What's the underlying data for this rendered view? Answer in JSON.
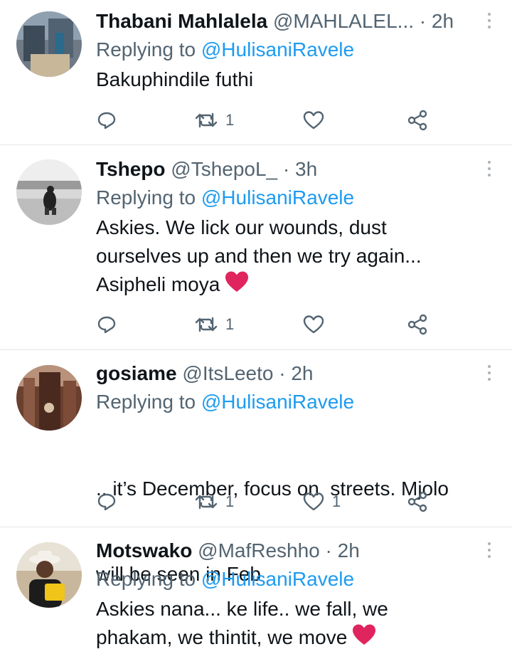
{
  "tweets": [
    {
      "name": "Thabani Mahlalela",
      "handle": "@MAHLALEL...",
      "dot": "·",
      "time": "2h",
      "replying_prefix": "Replying to",
      "replying_to": "@HulisaniRavele",
      "text_lines": [
        "Bakuphindile futhi"
      ],
      "heart_emoji": false,
      "retweets": "1",
      "likes": ""
    },
    {
      "name": "Tshepo",
      "handle": "@TshepoL_",
      "dot": "·",
      "time": "3h",
      "replying_prefix": "Replying to",
      "replying_to": "@HulisaniRavele",
      "text_lines": [
        "Askies. We lick our wounds, dust",
        "ourselves up and then we try again...",
        "Asipheli moya"
      ],
      "heart_emoji": true,
      "retweets": "1",
      "likes": ""
    },
    {
      "name": "gosiame",
      "handle": "@ItsLeeto",
      "dot": "·",
      "time": "2h",
      "replying_prefix": "Replying to",
      "replying_to": "@HulisaniRavele",
      "text_lines": [
        ".. it’s December, focus on  streets. Mjolo",
        "will be seen in Feb"
      ],
      "heart_emoji": false,
      "retweets": "1",
      "likes": "1"
    },
    {
      "name": "Motswako",
      "handle": "@MafReshho",
      "dot": "·",
      "time": "2h",
      "replying_prefix": "Replying to",
      "replying_to": "@HulisaniRavele",
      "text_lines": [
        "Askies nana... ke life.. we fall, we",
        "phakam, we thintit, we move"
      ],
      "heart_emoji": true,
      "retweets": "",
      "likes": ""
    }
  ],
  "icons": {
    "reply": "reply-icon",
    "retweet": "retweet-icon",
    "like": "like-icon",
    "share": "share-icon",
    "more": "more-icon",
    "heart_emoji": "red-heart-emoji"
  },
  "colors": {
    "name": "#0f1419",
    "secondary": "#536471",
    "mention": "#1d9bf0",
    "heart": "#e0245e",
    "divider": "#e2e6e9"
  }
}
